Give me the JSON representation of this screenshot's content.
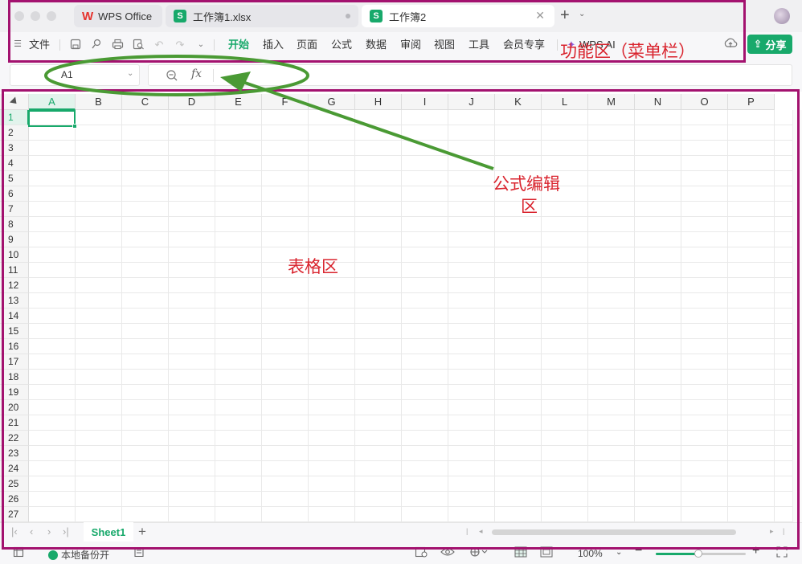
{
  "titlebar": {
    "tabs": [
      {
        "label": "WPS Office"
      },
      {
        "label": "工作簿1.xlsx"
      },
      {
        "label": "工作簿2"
      }
    ]
  },
  "menubar": {
    "file_label": "文件",
    "items": [
      "开始",
      "插入",
      "页面",
      "公式",
      "数据",
      "审阅",
      "视图",
      "工具",
      "会员专享",
      "WPS AI"
    ],
    "active_index": 0,
    "share_label": "分享"
  },
  "formula": {
    "cell_ref": "A1",
    "fx_label": "fx"
  },
  "grid": {
    "columns": [
      "A",
      "B",
      "C",
      "D",
      "E",
      "F",
      "G",
      "H",
      "I",
      "J",
      "K",
      "L",
      "M",
      "N",
      "O",
      "P"
    ],
    "rows": [
      "1",
      "2",
      "3",
      "4",
      "5",
      "6",
      "7",
      "8",
      "9",
      "10",
      "11",
      "12",
      "13",
      "14",
      "15",
      "16",
      "17",
      "18",
      "19",
      "20",
      "21",
      "22",
      "23",
      "24",
      "25",
      "26",
      "27"
    ],
    "selected_cell": "A1"
  },
  "sheets": {
    "tabs": [
      "Sheet1"
    ]
  },
  "status": {
    "backup_label": "本地备份开",
    "zoom_label": "100%",
    "zoom_fraction": 0.47
  },
  "annotations": {
    "function_area": "功能区（菜单栏）",
    "formula_area_line1": "公式编辑",
    "formula_area_line2": "区",
    "table_area": "表格区"
  },
  "colors": {
    "accent": "#18a96b",
    "annotation_box": "#a3126f",
    "annotation_text": "#d9232d",
    "annotation_arrow": "#4a9a34"
  }
}
